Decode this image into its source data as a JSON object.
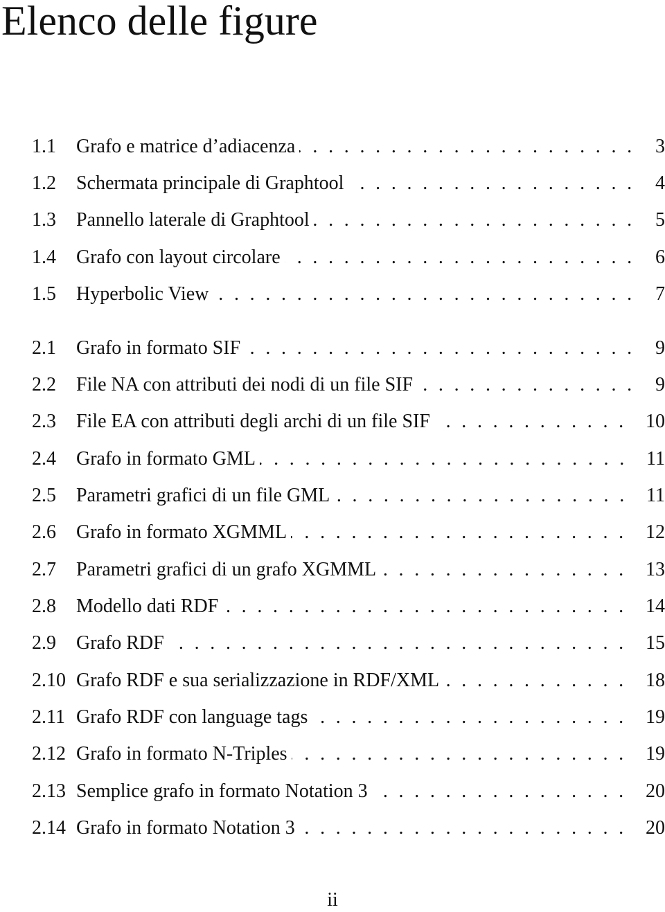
{
  "page": {
    "title": "Elenco delle figure",
    "page_number": "ii"
  },
  "figures": [
    {
      "number": "1.1",
      "label": "Grafo e matrice d’adiacenza",
      "page": "3"
    },
    {
      "number": "1.2",
      "label": "Schermata principale di Graphtool",
      "page": "4"
    },
    {
      "number": "1.3",
      "label": "Pannello laterale di Graphtool",
      "page": "5"
    },
    {
      "number": "1.4",
      "label": "Grafo con layout circolare",
      "page": "6"
    },
    {
      "number": "1.5",
      "label": "Hyperbolic View",
      "page": "7"
    },
    {
      "number": "2.1",
      "label": "Grafo in formato SIF",
      "page": "9"
    },
    {
      "number": "2.2",
      "label": "File NA con attributi dei nodi di un file SIF",
      "page": "9"
    },
    {
      "number": "2.3",
      "label": "File EA con attributi degli archi di un file SIF",
      "page": "10"
    },
    {
      "number": "2.4",
      "label": "Grafo in formato GML",
      "page": "11"
    },
    {
      "number": "2.5",
      "label": "Parametri grafici di un file GML",
      "page": "11"
    },
    {
      "number": "2.6",
      "label": "Grafo in formato XGMML",
      "page": "12"
    },
    {
      "number": "2.7",
      "label": "Parametri grafici di un grafo XGMML",
      "page": "13"
    },
    {
      "number": "2.8",
      "label": "Modello dati RDF",
      "page": "14"
    },
    {
      "number": "2.9",
      "label": "Grafo RDF",
      "page": "15"
    },
    {
      "number": "2.10",
      "label": "Grafo RDF e sua serializzazione in RDF/XML",
      "page": "18"
    },
    {
      "number": "2.11",
      "label": "Grafo RDF con language tags",
      "page": "19"
    },
    {
      "number": "2.12",
      "label": "Grafo in formato N-Triples",
      "page": "19"
    },
    {
      "number": "2.13",
      "label": "Semplice grafo in formato Notation 3",
      "page": "20"
    },
    {
      "number": "2.14",
      "label": "Grafo in formato Notation 3",
      "page": "20"
    }
  ]
}
